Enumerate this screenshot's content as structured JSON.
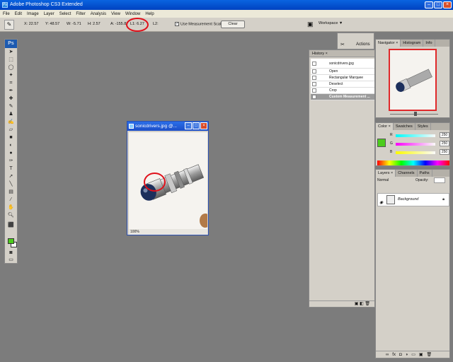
{
  "window": {
    "title": "Adobe Photoshop CS3 Extended"
  },
  "menu": [
    "File",
    "Edit",
    "Image",
    "Layer",
    "Select",
    "Filter",
    "Analysis",
    "View",
    "Window",
    "Help"
  ],
  "options": {
    "x": "X: 22.57",
    "y": "Y: 48.57",
    "w": "W: -5.71",
    "h": "H: 2.57",
    "angle": "A: -155.8°",
    "l1": "L1: 6.27",
    "l2": "L2:",
    "use_scale": "Use Measurement Scale",
    "clear": "Clear",
    "workspace": "Workspace ▼"
  },
  "toolbox": {
    "logo": "Ps"
  },
  "document": {
    "title": "sonicdrivers.jpg @...",
    "zoom": "100%"
  },
  "history": {
    "tab": "History ×",
    "snapshot": "sonicdrivers.jpg",
    "items": [
      "Open",
      "Rectangular Marquee",
      "Deselect",
      "Crop",
      "Custom Measurement ..."
    ]
  },
  "actions": {
    "tab": "Actions"
  },
  "navigator": {
    "tabs": [
      "Navigator ×",
      "Histogram",
      "Info"
    ]
  },
  "color": {
    "tabs": [
      "Color ×",
      "Swatches",
      "Styles"
    ],
    "rows": [
      {
        "label": "R",
        "value": "250"
      },
      {
        "label": "G",
        "value": "250"
      },
      {
        "label": "B",
        "value": "250"
      }
    ]
  },
  "layers": {
    "tabs": [
      "Layers ×",
      "Channels",
      "Paths"
    ],
    "blend": "Normal",
    "opacity": "Opacity:",
    "layer_name": "Background"
  }
}
